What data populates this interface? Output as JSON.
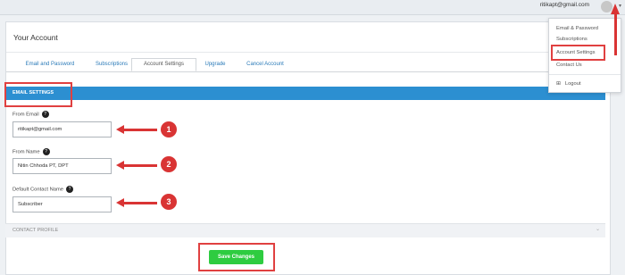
{
  "topbar": {
    "user_email": "ritikapt@gmail.com",
    "caret": "▾"
  },
  "card": {
    "title": "Your Account"
  },
  "tabs": [
    {
      "label": "Email and Password"
    },
    {
      "label": "Subscriptions"
    },
    {
      "label": "Account Settings",
      "active": true
    },
    {
      "label": "Upgrade"
    },
    {
      "label": "Cancel Account"
    }
  ],
  "email_settings": {
    "section_label": "EMAIL SETTINGS",
    "from_email": {
      "label": "From Email",
      "value": "ritikapt@gmail.com"
    },
    "from_name": {
      "label": "From Name",
      "value": "Nitin Chhoda PT, DPT"
    },
    "default_contact_name": {
      "label": "Default Contact Name",
      "value": "Subscriber"
    },
    "help_glyph": "?"
  },
  "contact_profile": {
    "label": "CONTACT PROFILE",
    "chevron": "⌄"
  },
  "save_button": {
    "label": "Save Changes"
  },
  "dropdown": {
    "items": [
      {
        "label": "Email & Password"
      },
      {
        "label": "Subscriptions"
      },
      {
        "label": "Account Settings"
      },
      {
        "label": "Contact Us"
      },
      {
        "label": "Logout"
      }
    ],
    "logout_icon": "⊞"
  },
  "annotations": {
    "badges": [
      "1",
      "2",
      "3"
    ],
    "color": "#d93434"
  },
  "colors": {
    "section_bar": "#2c8fd1",
    "save_button": "#2ecc40",
    "tab_link": "#2a7ab8"
  }
}
